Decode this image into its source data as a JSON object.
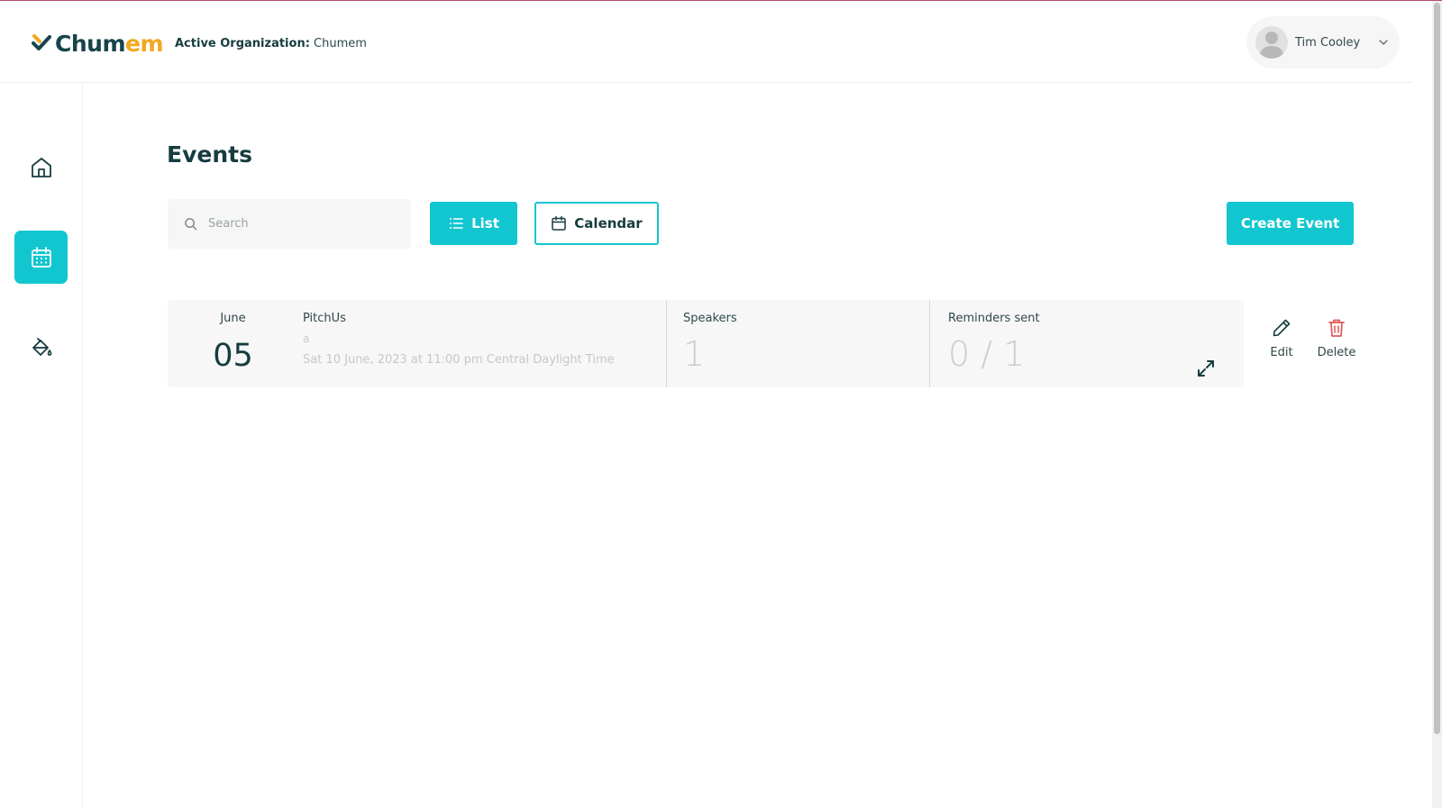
{
  "app": {
    "brand_prefix": "Chum",
    "brand_suffix": "em",
    "org_label": "Active Organization:",
    "org_name": "Chumem"
  },
  "user": {
    "name": "Tim Cooley"
  },
  "colors": {
    "accent": "#12c6d0",
    "brand_dark": "#17444a",
    "brand_orange": "#f2a81d",
    "danger": "#e25555"
  },
  "sidebar": {
    "items": [
      {
        "icon": "home-icon",
        "active": false
      },
      {
        "icon": "calendar-icon",
        "active": true
      },
      {
        "icon": "paint-bucket-icon",
        "active": false
      }
    ]
  },
  "page": {
    "title": "Events"
  },
  "toolbar": {
    "search_placeholder": "Search",
    "list_label": "List",
    "calendar_label": "Calendar",
    "create_label": "Create Event"
  },
  "events": [
    {
      "month": "June",
      "day": "05",
      "name": "PitchUs",
      "subtitle": "a",
      "when": "Sat 10 June, 2023 at 11:00 pm Central Daylight Time",
      "speakers_label": "Speakers",
      "speakers_count": "1",
      "reminders_label": "Reminders sent",
      "reminders_value": "0 / 1",
      "edit_label": "Edit",
      "delete_label": "Delete"
    }
  ]
}
